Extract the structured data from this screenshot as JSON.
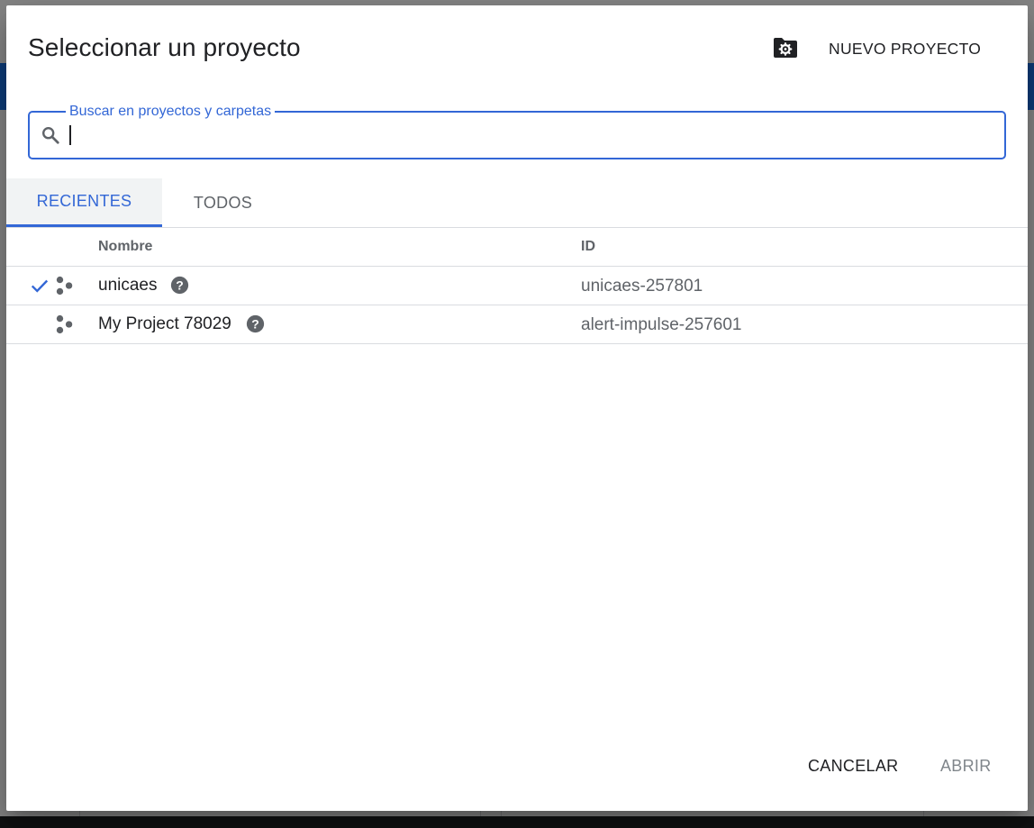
{
  "dialog": {
    "title": "Seleccionar un proyecto",
    "folder_icon": "folder-settings-icon",
    "new_project_label": "NUEVO PROYECTO"
  },
  "search": {
    "label": "Buscar en proyectos y carpetas",
    "value": "",
    "icon": "search-icon"
  },
  "tabs": [
    {
      "label": "RECIENTES",
      "active": true
    },
    {
      "label": "TODOS",
      "active": false
    }
  ],
  "table": {
    "columns": [
      "Nombre",
      "ID"
    ],
    "rows": [
      {
        "name": "unicaes",
        "id": "unicaes-257801",
        "selected": true
      },
      {
        "name": "My Project 78029",
        "id": "alert-impulse-257601",
        "selected": false
      }
    ]
  },
  "actions": {
    "cancel_label": "CANCELAR",
    "open_label": "ABRIR"
  },
  "colors": {
    "accent": "#3367d6",
    "text_primary": "#202124",
    "text_secondary": "#5f6368",
    "disabled": "#80868b",
    "scrim": "rgba(0,0,0,0.48)"
  }
}
